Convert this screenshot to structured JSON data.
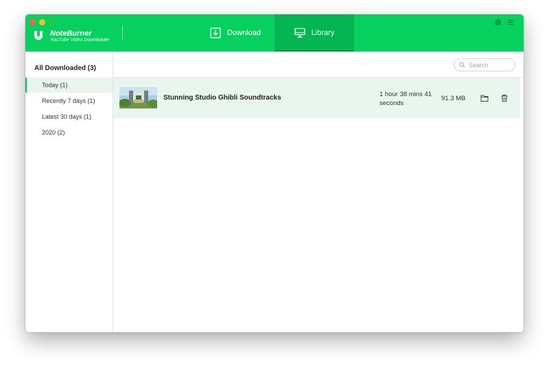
{
  "app": {
    "name": "NoteBurner",
    "subtitle": "YouTube Video Downloader"
  },
  "tabs": [
    {
      "label": "Download",
      "icon": "download-icon",
      "active": false
    },
    {
      "label": "Library",
      "icon": "monitor-icon",
      "active": true
    }
  ],
  "header_icons": [
    "gear-icon",
    "menu-icon"
  ],
  "sidebar": {
    "header": "All Downloaded (3)",
    "items": [
      {
        "label": "Today (1)",
        "active": true
      },
      {
        "label": "Recently 7 days (1)",
        "active": false
      },
      {
        "label": "Latest 30 days (1)",
        "active": false
      },
      {
        "label": "2020 (2)",
        "active": false
      }
    ]
  },
  "search": {
    "placeholder": "Search",
    "value": ""
  },
  "videos": [
    {
      "title": "Stunning Studio Ghibli Soundtracks",
      "duration": "1 hour 38 mins 41 seconds",
      "size": "91.3 MB",
      "actions": [
        "folder-icon",
        "trash-icon"
      ]
    }
  ],
  "colors": {
    "accent": "#06d15f",
    "accent_dark": "#04b652",
    "row_highlight": "#e9f6ee"
  }
}
